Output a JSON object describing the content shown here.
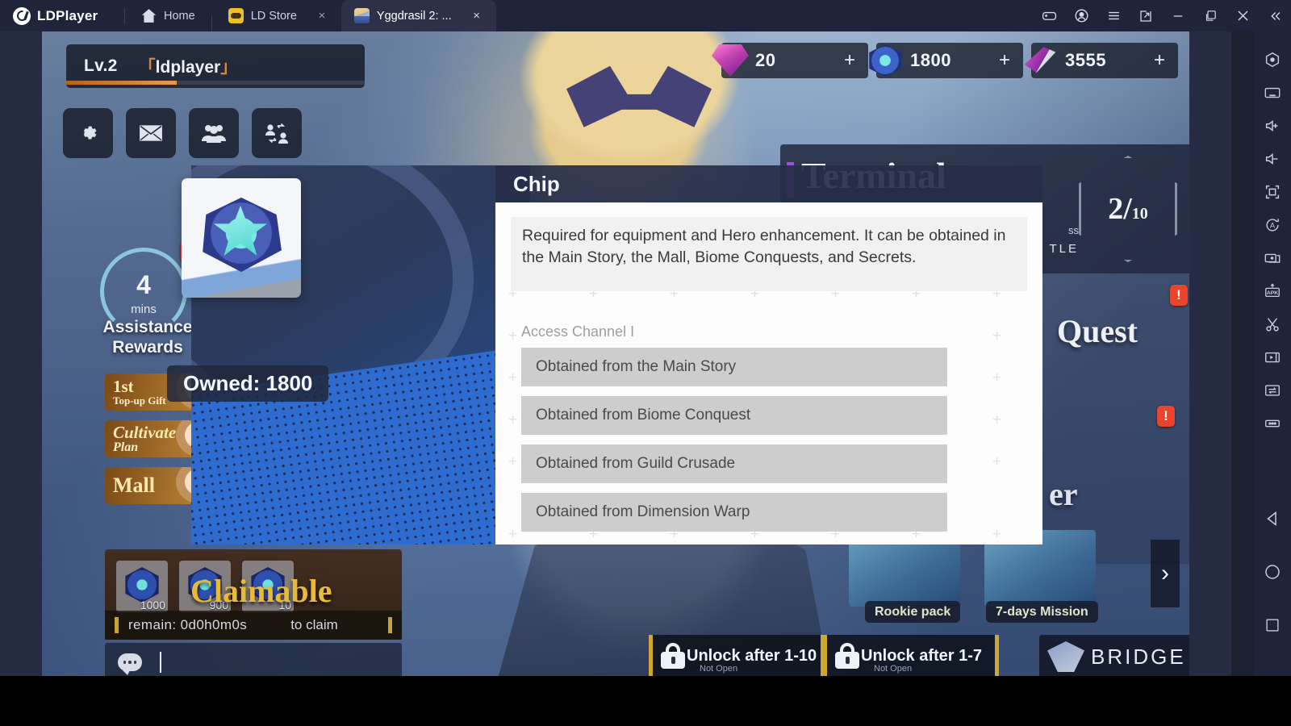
{
  "app": {
    "brand": "LDPlayer",
    "tabs": [
      {
        "label": "Home",
        "icon": "home-icon",
        "closable": false
      },
      {
        "label": "LD Store",
        "icon": "store-icon",
        "closable": true
      },
      {
        "label": "Yggdrasil 2: ...",
        "icon": "game-avatar-icon",
        "closable": true,
        "active": true
      }
    ],
    "window_controls": [
      {
        "name": "gamepad-icon"
      },
      {
        "name": "account-icon"
      },
      {
        "name": "menu-icon"
      },
      {
        "name": "resize-icon"
      },
      {
        "name": "minimize-icon"
      },
      {
        "name": "maximize-icon"
      },
      {
        "name": "close-icon"
      },
      {
        "name": "collapse-sidebar-icon"
      }
    ],
    "close_glyph": "×"
  },
  "toolbar": {
    "items": [
      {
        "name": "home-hex-icon"
      },
      {
        "name": "keyboard-icon"
      },
      {
        "name": "volume-up-icon"
      },
      {
        "name": "volume-down-icon"
      },
      {
        "name": "fullscreen-icon"
      },
      {
        "name": "auto-rotate-icon"
      },
      {
        "name": "multi-instance-icon"
      },
      {
        "name": "install-apk-icon"
      },
      {
        "name": "scissors-icon"
      },
      {
        "name": "record-video-icon"
      },
      {
        "name": "shared-folder-icon"
      },
      {
        "name": "more-options-icon"
      }
    ],
    "nav": [
      {
        "name": "android-back-icon"
      },
      {
        "name": "android-home-icon"
      },
      {
        "name": "android-recents-icon"
      }
    ]
  },
  "game": {
    "player": {
      "level": "Lv.2",
      "name_open_bracket": "「",
      "name": "ldplayer",
      "name_close_bracket": "」"
    },
    "quick_buttons": [
      {
        "name": "settings-gear-button",
        "icon": "gear-icon"
      },
      {
        "name": "mail-button",
        "icon": "mail-icon"
      },
      {
        "name": "friends-button",
        "icon": "group-icon"
      },
      {
        "name": "invite-button",
        "icon": "user-swap-icon"
      }
    ],
    "currencies": [
      {
        "name": "diamond",
        "icon": "diamond-gem-icon",
        "value": "20",
        "plus": "+"
      },
      {
        "name": "chip",
        "icon": "chip-gem-icon",
        "value": "1800",
        "plus": "+"
      },
      {
        "name": "stamina",
        "icon": "stamina-icon",
        "value": "3555",
        "plus": "+"
      }
    ],
    "terminal": {
      "title": "Terminal",
      "badge_value": "2",
      "badge_max": "10",
      "label_small": "ss",
      "label": "TLE"
    },
    "quest": {
      "label": "Quest",
      "label2": "er",
      "alert": "!"
    },
    "assistance": {
      "minutes": "4",
      "unit": "mins",
      "title_line1": "Assistance",
      "title_line2": "Rewards",
      "alert": "!"
    },
    "promos": [
      {
        "line1": "1st",
        "line2": "Top-up Gift",
        "alert": ""
      },
      {
        "line1": "Cultivate",
        "line2": "Plan",
        "alert": "!"
      },
      {
        "line1": "Mall",
        "line2": "",
        "alert": "!"
      }
    ],
    "claimable": {
      "word": "Claimable",
      "items": [
        {
          "count": "1000"
        },
        {
          "count": "900"
        },
        {
          "count": "10"
        }
      ],
      "remain_label": "remain:  0d0h0m0s",
      "to_claim_label": "to claim"
    },
    "chat": {
      "placeholder": "",
      "value": ""
    },
    "bottom_buttons": [
      {
        "label": "Unlock after 1-10",
        "sub": "Not Open",
        "icon": "lock-icon"
      },
      {
        "label": "Unlock after 1-7",
        "sub": "Not Open",
        "icon": "lock-icon"
      }
    ],
    "bridge": {
      "label": "BRIDGE",
      "icon": "bridge-emblem-icon"
    },
    "event_tags": [
      {
        "label": "Rookie pack"
      },
      {
        "label": "7-days Mission"
      }
    ],
    "next_arrow": "›"
  },
  "modal": {
    "title": "Chip",
    "description": "Required for equipment and Hero enhancement. It can be obtained in the Main Story, the Mall, Biome Conquests, and Secrets.",
    "access_channel_label": "Access Channel I",
    "channels": [
      "Obtained from the Main Story",
      "Obtained from Biome Conquest",
      "Obtained from Guild Crusade",
      "Obtained from Dimension Warp"
    ],
    "owned_label": "Owned: 1800",
    "item_icon": "chip-item-icon"
  },
  "colors": {
    "titlebar_bg": "#20243a",
    "tab_active_bg": "#2c3149",
    "modal_header_bg": "#262e48",
    "modal_body_bg": "#fdfdfd",
    "channel_row_bg": "#cdcdcd",
    "accent_gold": "#e8b93a",
    "alert_red": "#e8452c",
    "terminal_accent": "#9b4fe0"
  }
}
